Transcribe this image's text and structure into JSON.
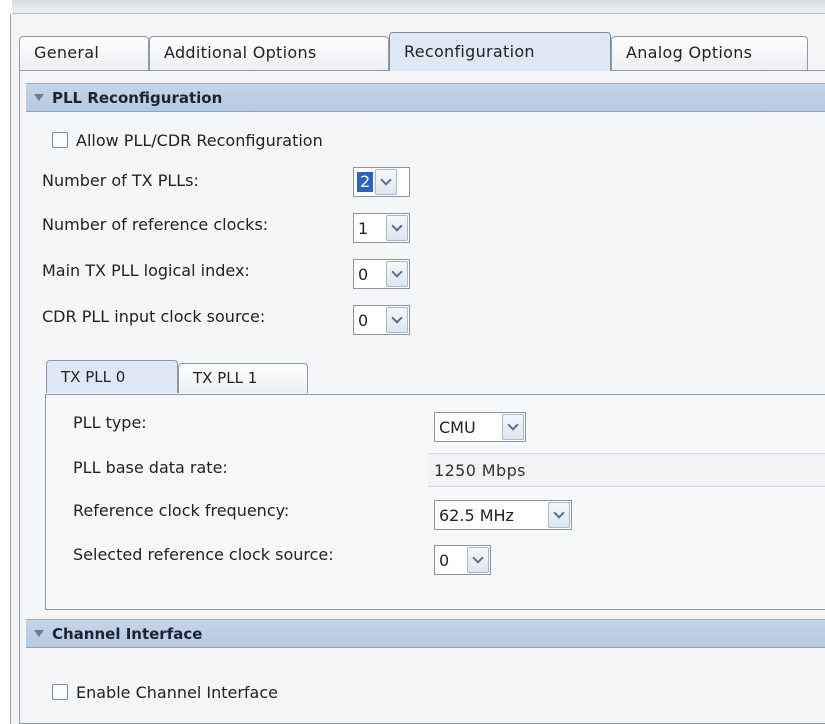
{
  "tabs": [
    {
      "label": "General"
    },
    {
      "label": "Additional Options"
    },
    {
      "label": "Reconfiguration"
    },
    {
      "label": "Analog Options"
    }
  ],
  "pll_section": {
    "title": "PLL Reconfiguration",
    "allow_reconfig_label": "Allow PLL/CDR Reconfiguration",
    "num_tx_plls": {
      "label": "Number of TX PLLs:",
      "value": "2"
    },
    "num_ref_clocks": {
      "label": "Number of reference clocks:",
      "value": "1"
    },
    "main_tx_pll_index": {
      "label": "Main TX PLL logical index:",
      "value": "0"
    },
    "cdr_input_clock": {
      "label": "CDR PLL input clock source:",
      "value": "0"
    }
  },
  "inner_tabs": [
    {
      "label": "TX PLL 0"
    },
    {
      "label": "TX PLL 1"
    }
  ],
  "tx_pll": {
    "pll_type": {
      "label": "PLL type:",
      "value": "CMU"
    },
    "base_data_rate": {
      "label": "PLL base data rate:",
      "value": "1250 Mbps"
    },
    "ref_clock_freq": {
      "label": "Reference clock frequency:",
      "value": "62.5 MHz"
    },
    "selected_ref_clock": {
      "label": "Selected reference clock source:",
      "value": "0"
    }
  },
  "channel_section": {
    "title": "Channel Interface",
    "enable_label": "Enable Channel Interface"
  }
}
